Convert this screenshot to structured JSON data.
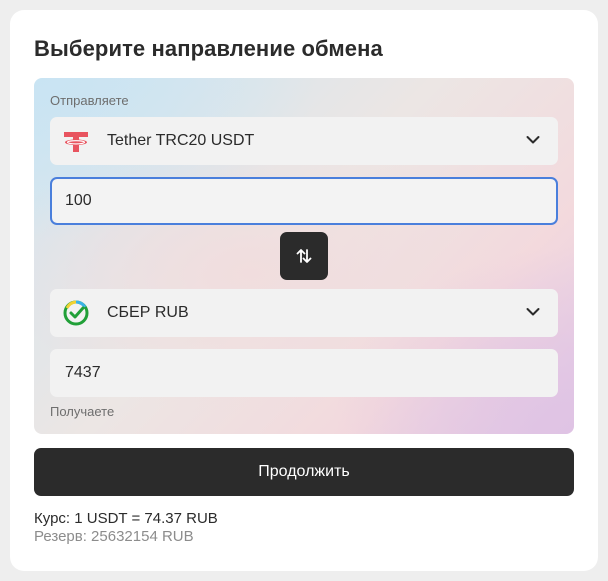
{
  "title": "Выберите направление обмена",
  "send": {
    "label": "Отправляете",
    "currency": "Tether TRC20 USDT",
    "currency_icon": "tether-icon",
    "amount": "100"
  },
  "receive": {
    "label": "Получаете",
    "currency": "СБЕР RUB",
    "currency_icon": "sber-icon",
    "amount": "7437"
  },
  "swap_icon": "swap-arrows-icon",
  "continue_label": "Продолжить",
  "rate_text": "Курс: 1 USDT = 74.37 RUB",
  "reserve_text": "Резерв: 25632154 RUB",
  "colors": {
    "tether": "#e8545f",
    "sber_green": "#21a038",
    "primary_button": "#2b2b2b",
    "focus_border": "#4a7fdc"
  }
}
